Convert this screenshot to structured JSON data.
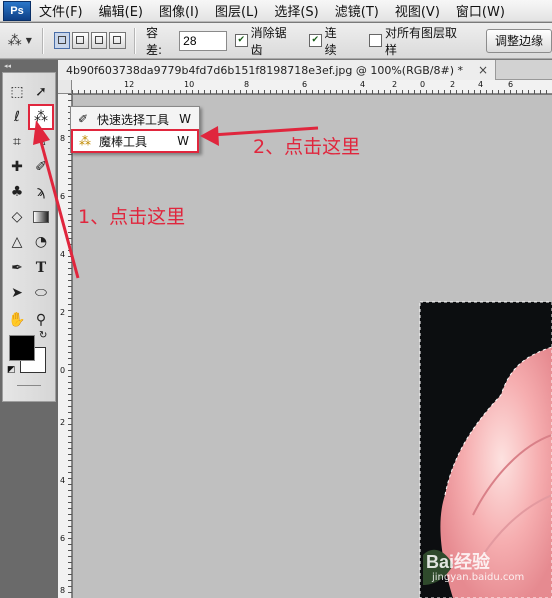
{
  "app": {
    "logo_text": "Ps"
  },
  "menubar": {
    "items": [
      "文件(F)",
      "编辑(E)",
      "图像(I)",
      "图层(L)",
      "选择(S)",
      "滤镜(T)",
      "视图(V)",
      "窗口(W)"
    ]
  },
  "options": {
    "tolerance_label": "容差:",
    "tolerance_value": "28",
    "antialias_label": "消除锯齿",
    "antialias_checked": true,
    "contiguous_label": "连续",
    "contiguous_checked": true,
    "sample_all_label": "对所有图层取样",
    "sample_all_checked": false,
    "refine_edge_label": "调整边缘"
  },
  "toolbox": {
    "collapse_glyph": "◂◂"
  },
  "document": {
    "tab_title": "4b90f603738da9779b4fd7d6b151f8198718e3ef.jpg @ 100%(RGB/8#) *",
    "close_glyph": "×"
  },
  "ruler": {
    "top_labels": [
      "12",
      "10",
      "8",
      "6",
      "4",
      "2",
      "0",
      "2",
      "4",
      "6"
    ],
    "left_labels": [
      "8",
      "6",
      "4",
      "2",
      "0",
      "2",
      "4",
      "6",
      "8"
    ]
  },
  "flyout": {
    "items": [
      {
        "icon": "quick-selection-icon",
        "label": "快速选择工具",
        "shortcut": "W"
      },
      {
        "icon": "magic-wand-icon",
        "label": "魔棒工具",
        "shortcut": "W"
      }
    ]
  },
  "annotations": {
    "step1": "1、点击这里",
    "step2": "2、点击这里",
    "color": "#e0263d"
  },
  "watermark": {
    "logo": "Bai经验",
    "url": "jingyan.baidu.com"
  }
}
